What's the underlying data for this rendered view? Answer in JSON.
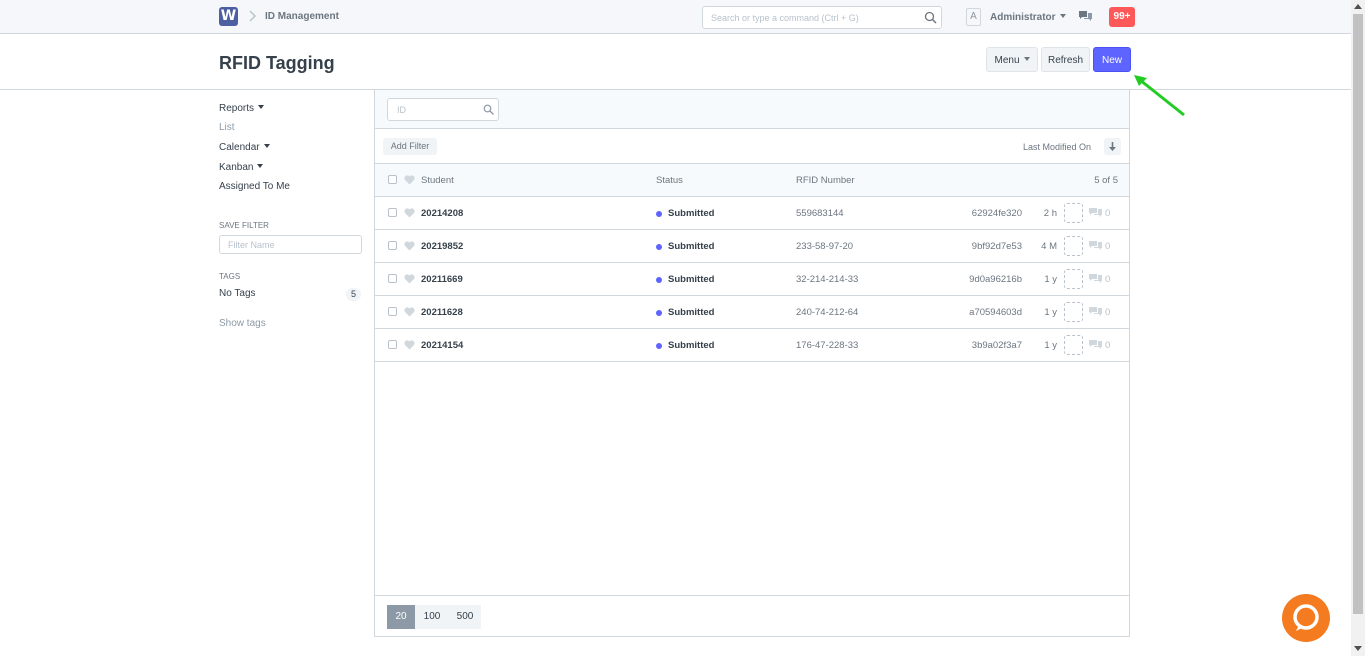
{
  "navbar": {
    "logo": "W",
    "breadcrumb": "ID Management",
    "search_placeholder": "Search or type a command (Ctrl + G)",
    "avatar_letter": "A",
    "user_name": "Administrator",
    "notifications": "99+"
  },
  "page": {
    "title": "RFID Tagging",
    "menu_label": "Menu",
    "refresh_label": "Refresh",
    "new_label": "New"
  },
  "sidebar": {
    "reports": "Reports",
    "list": "List",
    "calendar": "Calendar",
    "kanban": "Kanban",
    "assigned": "Assigned To Me",
    "save_filter_heading": "SAVE FILTER",
    "filter_placeholder": "Filter Name",
    "tags_heading": "TAGS",
    "no_tags": "No Tags",
    "no_tags_count": "5",
    "show_tags": "Show tags"
  },
  "list": {
    "id_placeholder": "ID",
    "add_filter": "Add Filter",
    "sort_label": "Last Modified On",
    "columns": {
      "student": "Student",
      "status": "Status",
      "rfid": "RFID Number",
      "count": "5 of 5"
    },
    "rows": [
      {
        "student": "20214208",
        "status": "Submitted",
        "rfid": "559683144",
        "name": "62924fe320",
        "time": "2 h",
        "comments": "0"
      },
      {
        "student": "20219852",
        "status": "Submitted",
        "rfid": "233-58-97-20",
        "name": "9bf92d7e53",
        "time": "4 M",
        "comments": "0"
      },
      {
        "student": "20211669",
        "status": "Submitted",
        "rfid": "32-214-214-33",
        "name": "9d0a96216b",
        "time": "1 y",
        "comments": "0"
      },
      {
        "student": "20211628",
        "status": "Submitted",
        "rfid": "240-74-212-64",
        "name": "a70594603d",
        "time": "1 y",
        "comments": "0"
      },
      {
        "student": "20214154",
        "status": "Submitted",
        "rfid": "176-47-228-33",
        "name": "3b9a02f3a7",
        "time": "1 y",
        "comments": "0"
      }
    ],
    "page_sizes": [
      "20",
      "100",
      "500"
    ]
  },
  "colors": {
    "primary": "#5e64ff",
    "status_dot": "#5e64ff",
    "badge": "#ff5858",
    "arrow": "#22cc22",
    "chat_fab": "#f47b20"
  },
  "icons": [
    "logo-icon",
    "chevron-right-icon",
    "search-icon",
    "caret-down-icon",
    "chat-icon",
    "heart-icon",
    "comment-icon",
    "sort-arrow-icon",
    "chat-bubble-icon",
    "annotation-arrow"
  ]
}
